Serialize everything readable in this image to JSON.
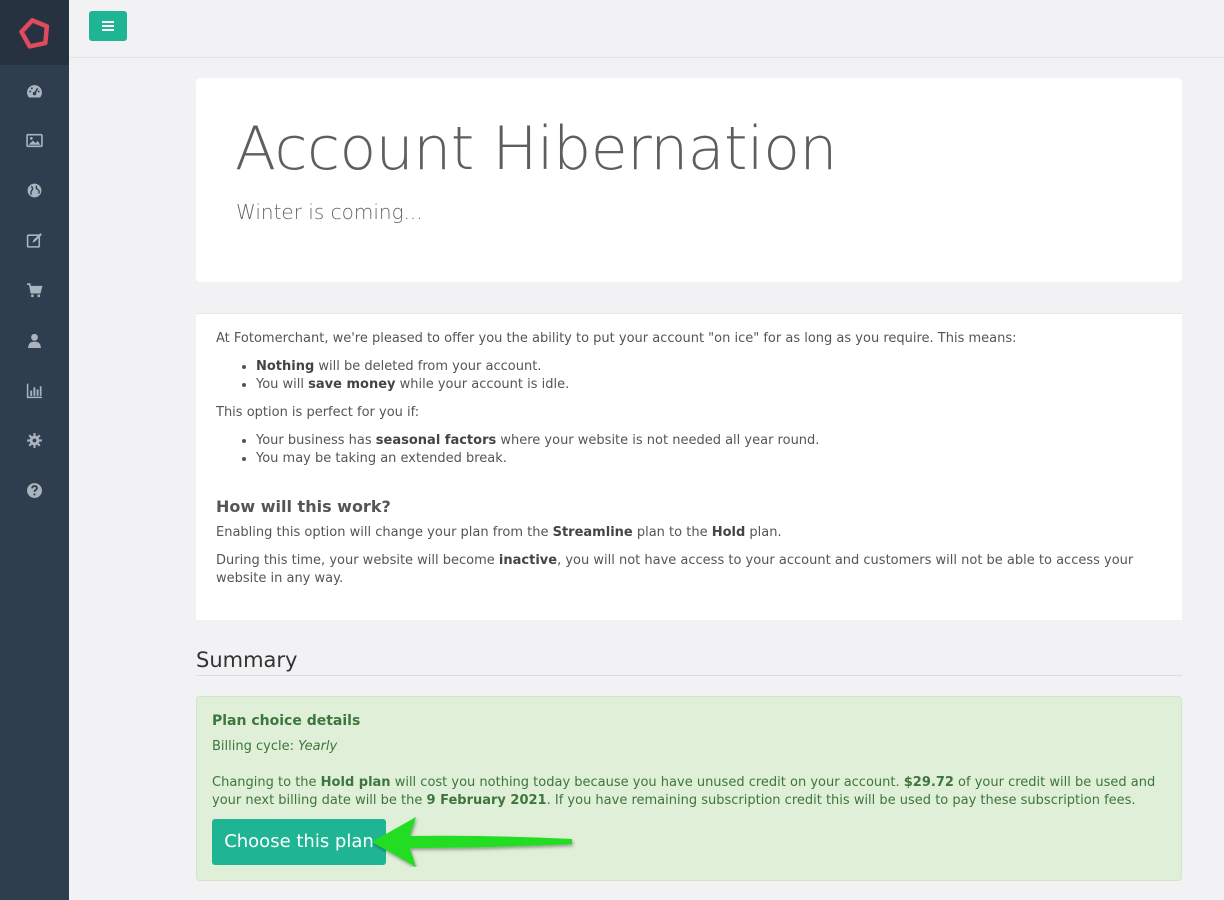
{
  "sidebar": {
    "logo_icon": "pentagon-logo-icon",
    "items": [
      {
        "name": "dashboard-icon"
      },
      {
        "name": "image-icon"
      },
      {
        "name": "globe-icon"
      },
      {
        "name": "edit-icon"
      },
      {
        "name": "cart-icon"
      },
      {
        "name": "user-icon"
      },
      {
        "name": "bar-chart-icon"
      },
      {
        "name": "gear-icon"
      },
      {
        "name": "help-icon"
      }
    ]
  },
  "topbar": {
    "menu_icon": "hamburger-icon"
  },
  "hero": {
    "title": "Account Hibernation",
    "subtitle": "Winter is coming..."
  },
  "info": {
    "intro": "At Fotomerchant, we're pleased to offer you the ability to put your account \"on ice\" for as long as you require. This means:",
    "benefits": [
      {
        "bold": "Nothing",
        "text": " will be deleted from your account."
      },
      {
        "pre": "You will ",
        "bold": "save money",
        "text": " while your account is idle."
      }
    ],
    "perfect_if": "This option is perfect for you if:",
    "reasons": [
      {
        "pre": "Your business has ",
        "bold": "seasonal factors",
        "text": " where your website is not needed all year round."
      },
      {
        "text": "You may be taking an extended break."
      }
    ],
    "how_title": "How will this work?",
    "how_p1_a": "Enabling this option will change your plan from the ",
    "how_p1_b": "Streamline",
    "how_p1_c": " plan to the ",
    "how_p1_d": "Hold",
    "how_p1_e": " plan.",
    "how_p2_a": "During this time, your website will become ",
    "how_p2_b": "inactive",
    "how_p2_c": ", you will not have access to your account and customers will not be able to access your website in any way."
  },
  "summary": {
    "title": "Summary",
    "plan_heading": "Plan choice details",
    "cycle_label": "Billing cycle: ",
    "cycle_value": "Yearly",
    "detail_a": "Changing to the ",
    "detail_b": "Hold plan",
    "detail_c": " will cost you nothing today because you have unused credit on your account. ",
    "detail_d": "$29.72",
    "detail_e": " of your credit will be used and your next billing date will be the ",
    "detail_f": "9 February 2021",
    "detail_g": ". If you have remaining subscription credit this will be used to pay these subscription fees.",
    "button_label": "Choose this plan"
  },
  "colors": {
    "sidebar": "#2e3e4e",
    "accent": "#1fb594",
    "logo": "#e04a5f",
    "success_bg": "#dfefd8",
    "success_text": "#3c763d",
    "arrow": "#22dd22"
  }
}
